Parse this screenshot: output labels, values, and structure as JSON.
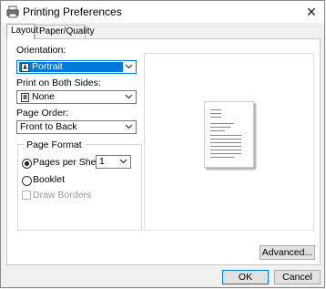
{
  "window": {
    "title": "Printing Preferences"
  },
  "tabs": [
    {
      "label": "Layout",
      "active": true
    },
    {
      "label": "Paper/Quality",
      "active": false
    }
  ],
  "layout": {
    "orientation": {
      "label": "Orientation:",
      "value": "Portrait"
    },
    "print_both_sides": {
      "label": "Print on Both Sides:",
      "value": "None"
    },
    "page_order": {
      "label": "Page Order:",
      "value": "Front to Back"
    },
    "page_format": {
      "title": "Page Format",
      "pages_per_sheet_label": "Pages per Sheet",
      "pages_per_sheet_value": "1",
      "pages_per_sheet_selected": true,
      "booklet_label": "Booklet",
      "draw_borders_label": "Draw Borders"
    }
  },
  "buttons": {
    "advanced": "Advanced...",
    "ok": "OK",
    "cancel": "Cancel"
  },
  "colors": {
    "accent": "#0078d7",
    "window_bg": "#f0f0f0"
  },
  "icons": {
    "title": "printer-icon",
    "close": "close-icon",
    "orientation": "portrait-page-icon",
    "both_sides": "duplex-page-icon"
  }
}
